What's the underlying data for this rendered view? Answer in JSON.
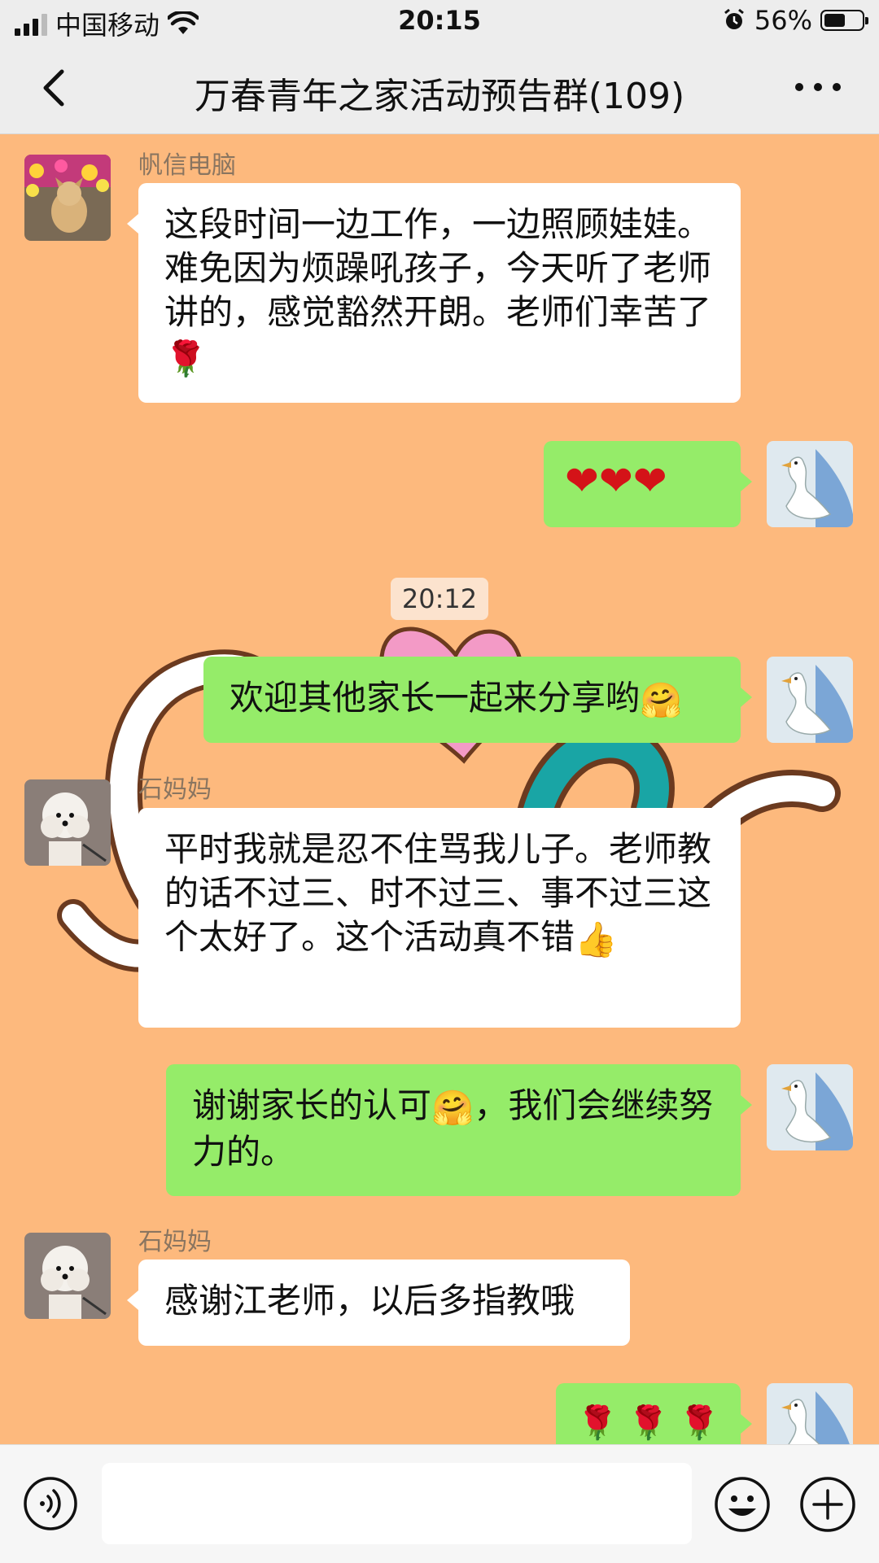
{
  "status_bar": {
    "carrier": "中国移动",
    "time": "20:15",
    "battery": "56%",
    "battery_level": 0.56
  },
  "header": {
    "title": "万春青年之家活动预告群(109)",
    "back_icon": "chevron-left-icon",
    "more_icon": "ellipsis-icon"
  },
  "messages": [
    {
      "side": "left",
      "sender": "帆信电脑",
      "text": "这段时间一边工作，一边照顾娃娃。难免因为烦躁吼孩子，今天听了老师讲的，感觉豁然开朗。老师们幸苦了",
      "emoji": "🌹"
    },
    {
      "side": "right",
      "text": "❤❤❤"
    },
    {
      "side": "center",
      "time": "20:12"
    },
    {
      "side": "right",
      "text": "欢迎其他家长一起来分享哟",
      "emoji": "🤗"
    },
    {
      "side": "left",
      "sender": "石妈妈",
      "text": "平时我就是忍不住骂我儿子。老师教的话不过三、时不过三、事不过三这个太好了。这个活动真不错",
      "emoji": "👍"
    },
    {
      "side": "right",
      "text_a": "谢谢家长的认可",
      "emoji": "🤗",
      "text_b": "，我们会继续努力的。"
    },
    {
      "side": "left",
      "sender": "石妈妈",
      "text": "感谢江老师，以后多指教哦"
    },
    {
      "side": "right",
      "text": "🌹 🌹 🌹"
    }
  ],
  "input_bar": {
    "voice_icon": "voice-icon",
    "emoji_icon": "smiley-icon",
    "plus_icon": "plus-icon",
    "placeholder": ""
  },
  "colors": {
    "chat_bg": "#FDB97D",
    "bubble_right": "#95EC69",
    "bubble_left": "#FFFFFF",
    "bar_bg": "#EDEDED"
  }
}
